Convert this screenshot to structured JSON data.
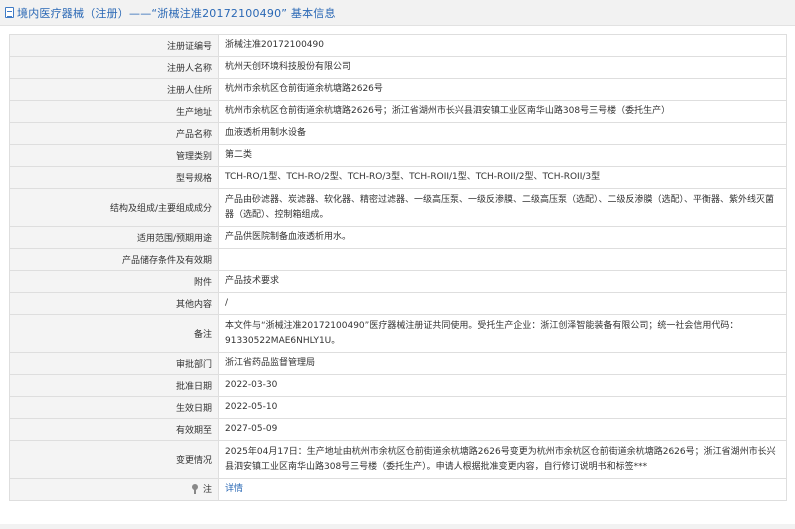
{
  "header": {
    "title": "境内医疗器械（注册）——“浙械注准20172100490” 基本信息"
  },
  "rows": [
    {
      "label": "注册证编号",
      "value": "浙械注准20172100490"
    },
    {
      "label": "注册人名称",
      "value": "杭州天创环境科技股份有限公司"
    },
    {
      "label": "注册人住所",
      "value": "杭州市余杭区仓前街道余杭塘路2626号"
    },
    {
      "label": "生产地址",
      "value": "杭州市余杭区仓前街道余杭塘路2626号；浙江省湖州市长兴县泗安镇工业区南华山路308号三号楼（委托生产）"
    },
    {
      "label": "产品名称",
      "value": "血液透析用制水设备"
    },
    {
      "label": "管理类别",
      "value": "第二类"
    },
    {
      "label": "型号规格",
      "value": "TCH-RO/1型、TCH-RO/2型、TCH-RO/3型、TCH-ROII/1型、TCH-ROII/2型、TCH-ROII/3型"
    },
    {
      "label": "结构及组成/主要组成成分",
      "value": "产品由砂滤器、炭滤器、软化器、精密过滤器、一级高压泵、一级反渗膜、二级高压泵（选配）、二级反渗膜（选配）、平衡器、紫外线灭菌器（选配）、控制箱组成。"
    },
    {
      "label": "适用范围/预期用途",
      "value": "产品供医院制备血液透析用水。"
    },
    {
      "label": "产品储存条件及有效期",
      "value": ""
    },
    {
      "label": "附件",
      "value": "产品技术要求"
    },
    {
      "label": "其他内容",
      "value": "/"
    },
    {
      "label": "备注",
      "value": "本文件与“浙械注准20172100490”医疗器械注册证共同使用。受托生产企业：浙江创泽智能装备有限公司；统一社会信用代码：91330522MAE6NHLY1U。"
    },
    {
      "label": "审批部门",
      "value": "浙江省药品监督管理局"
    },
    {
      "label": "批准日期",
      "value": "2022-03-30"
    },
    {
      "label": "生效日期",
      "value": "2022-05-10"
    },
    {
      "label": "有效期至",
      "value": "2027-05-09"
    },
    {
      "label": "变更情况",
      "value": "2025年04月17日：生产地址由杭州市余杭区仓前街道余杭塘路2626号变更为杭州市余杭区仓前街道余杭塘路2626号；浙江省湖州市长兴县泗安镇工业区南华山路308号三号楼（委托生产）。申请人根据批准变更内容，自行修订说明书和标签***"
    }
  ],
  "note_row": {
    "label": "注",
    "link": "详情",
    "icon": "info-pin-icon"
  }
}
